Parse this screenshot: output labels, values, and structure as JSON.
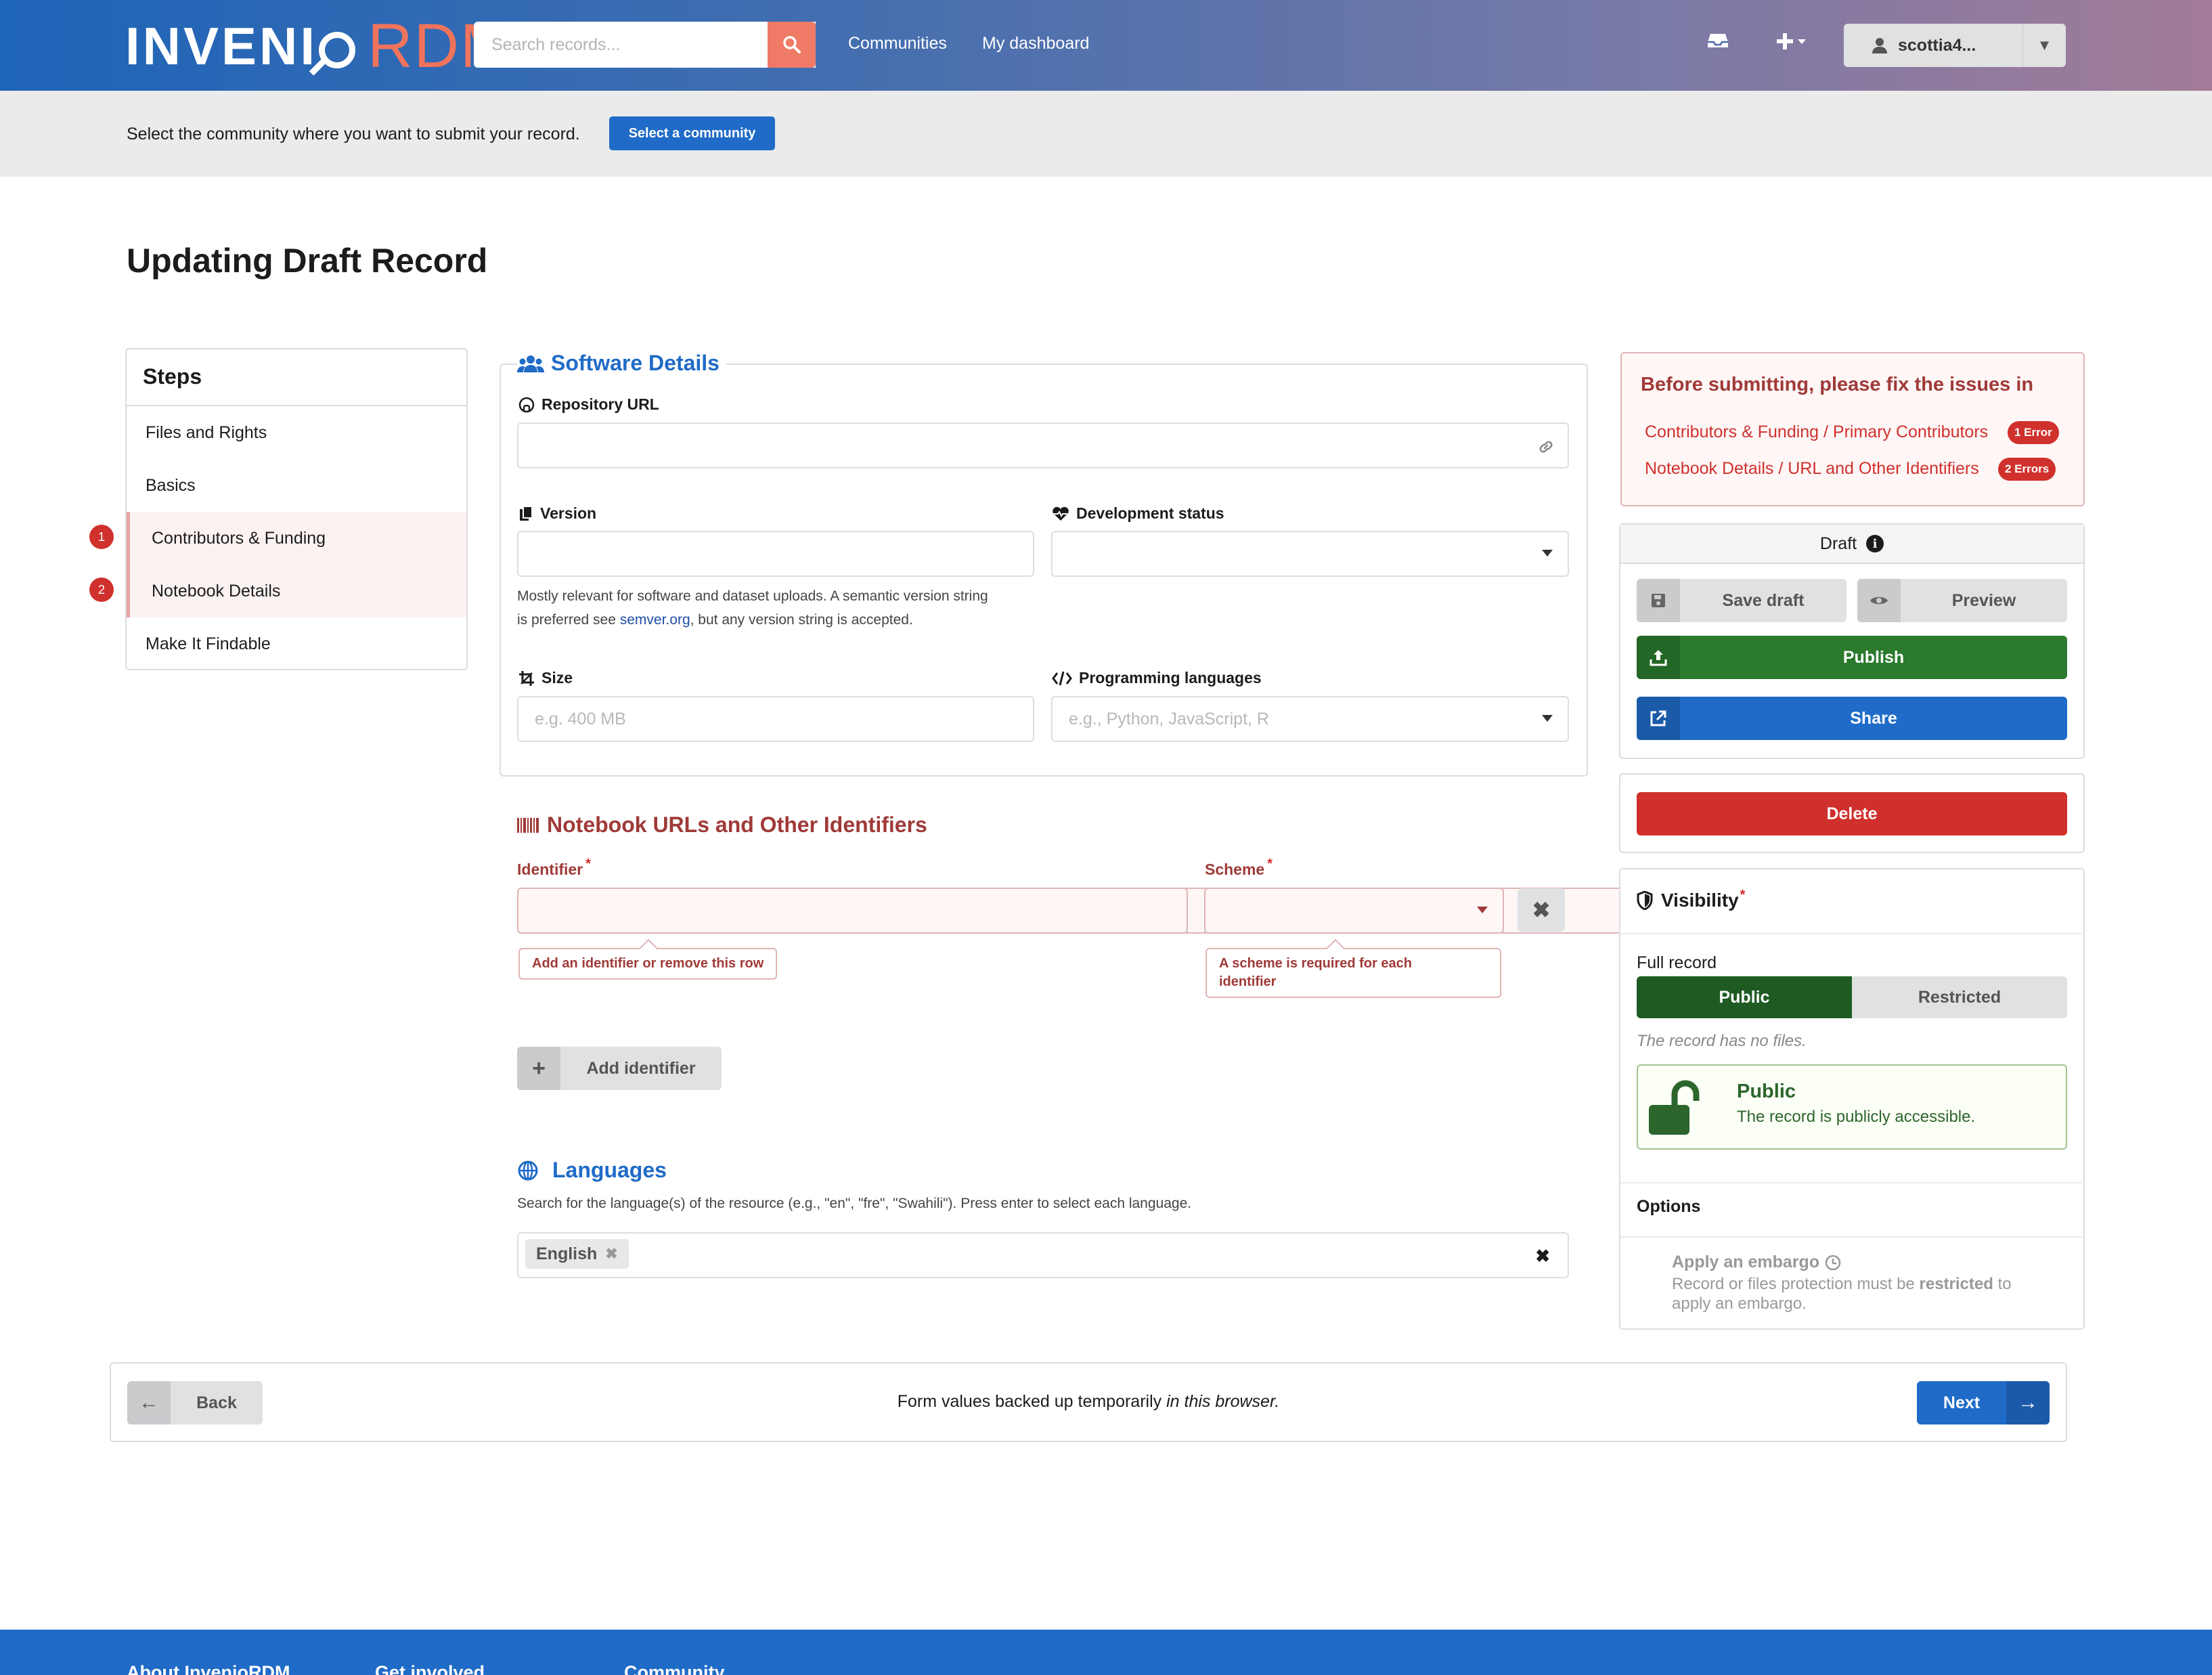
{
  "header": {
    "logo_left": "INVENI",
    "logo_right": "RDM",
    "search_placeholder": "Search records...",
    "nav": [
      "Communities",
      "My dashboard"
    ],
    "user": "scottia4..."
  },
  "community_bar": {
    "text": "Select the community where you want to submit your record.",
    "button": "Select a community"
  },
  "page_title": "Updating Draft Record",
  "steps": {
    "title": "Steps",
    "items": [
      {
        "label": "Files and Rights",
        "badge": ""
      },
      {
        "label": "Basics",
        "badge": ""
      },
      {
        "label": "Contributors & Funding",
        "badge": "1"
      },
      {
        "label": "Notebook Details",
        "badge": "2"
      },
      {
        "label": "Make It Findable",
        "badge": ""
      }
    ]
  },
  "software": {
    "title": "Software Details",
    "repo_label": "Repository URL",
    "version_label": "Version",
    "version_help_1": "Mostly relevant for software and dataset uploads. A semantic version string",
    "version_help_2a": "is preferred see ",
    "version_help_link": "semver.org",
    "version_help_2b": ", but any version string is accepted.",
    "devstatus_label": "Development status",
    "size_label": "Size",
    "size_placeholder": "e.g. 400 MB",
    "proglang_label": "Programming languages",
    "proglang_placeholder": "e.g., Python, JavaScript, R"
  },
  "identifiers": {
    "title": "Notebook URLs and Other Identifiers",
    "identifier_label": "Identifier",
    "scheme_label": "Scheme",
    "required_mark": "*",
    "identifier_error": "Add an identifier or remove this row",
    "scheme_error_1": "A scheme is required for each",
    "scheme_error_2": "identifier",
    "add_button": "Add identifier"
  },
  "languages": {
    "title": "Languages",
    "help": "Search for the language(s) of the resource (e.g., \"en\", \"fre\", \"Swahili\"). Press enter to select each language.",
    "selected": "English"
  },
  "errors": {
    "title": "Before submitting, please fix the issues in",
    "items": [
      {
        "link": "Contributors & Funding / Primary Contributors",
        "badge": "1 Error"
      },
      {
        "link": "Notebook Details / URL and Other Identifiers",
        "badge": "2 Errors"
      }
    ]
  },
  "actions": {
    "status": "Draft",
    "save": "Save draft",
    "preview": "Preview",
    "publish": "Publish",
    "share": "Share",
    "delete": "Delete"
  },
  "visibility": {
    "title": "Visibility",
    "required_mark": "*",
    "full_record": "Full record",
    "public": "Public",
    "restricted": "Restricted",
    "no_files": "The record has no files.",
    "public_title": "Public",
    "public_desc": "The record is publicly accessible.",
    "options": "Options",
    "embargo_title": "Apply an embargo",
    "embargo_desc_1a": "Record or files protection must be ",
    "embargo_desc_bold": "restricted",
    "embargo_desc_1b": " to",
    "embargo_desc_2": "apply an embargo."
  },
  "bottom": {
    "back": "Back",
    "note_a": "Form values backed up temporarily ",
    "note_em": "in this browser.",
    "next": "Next"
  },
  "footer": [
    "About InvenioRDM",
    "Get involved",
    "Community"
  ],
  "colors": {
    "primary": "#1f6bc7",
    "error": "#9f3a38",
    "success": "#2b7a2e",
    "danger": "#cf302c"
  }
}
